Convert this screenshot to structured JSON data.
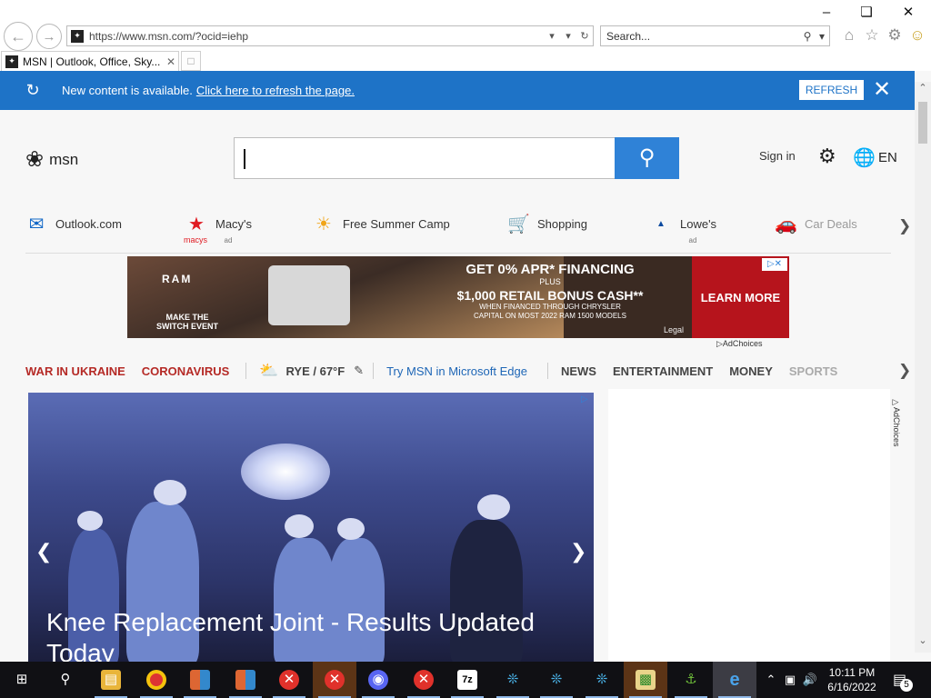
{
  "browser": {
    "address_url": "https://www.msn.com/?ocid=iehp",
    "search_placeholder": "Search...",
    "tab_title": "MSN | Outlook, Office, Sky...",
    "icons": [
      "back-icon",
      "forward-icon",
      "refresh-icon",
      "home-icon",
      "favorites-star-icon",
      "tools-gear-icon",
      "smiley-feedback-icon"
    ]
  },
  "notification": {
    "text": "New content is available.",
    "link": "Click here to refresh the page.",
    "button": "REFRESH",
    "close": "✕"
  },
  "msn": {
    "logo_text": "msn",
    "sign_in": "Sign in",
    "language": "EN",
    "quick_links": [
      {
        "label": "Outlook.com",
        "icon": "outlook-icon",
        "ad": ""
      },
      {
        "label": "Macy's",
        "icon": "macys-star-icon",
        "ad": "ad",
        "sub": "macys"
      },
      {
        "label": "Free Summer Camp",
        "icon": "sun-icon",
        "ad": ""
      },
      {
        "label": "Shopping",
        "icon": "shopping-cart-icon",
        "ad": ""
      },
      {
        "label": "Lowe's",
        "icon": "lowes-icon",
        "ad": "ad",
        "sub": "Lowe's"
      },
      {
        "label": "Car Deals",
        "icon": "car-icon",
        "ad": ""
      }
    ],
    "ad_banner": {
      "brand": "RAM",
      "slogan_line1": "MAKE THE",
      "slogan_line2": "SWITCH EVENT",
      "headline": "GET 0% APR* FINANCING",
      "plus": "PLUS",
      "bonus": "$1,000 RETAIL BONUS CASH**",
      "fine1": "WHEN FINANCED THROUGH CHRYSLER",
      "fine2": "CAPITAL ON MOST 2022 RAM 1500 MODELS",
      "cta": "LEARN MORE",
      "legal": "Legal",
      "adchoices": "AdChoices"
    },
    "topics": {
      "war": "WAR IN UKRAINE",
      "corona": "CORONAVIRUS",
      "weather": "RYE / 67°F",
      "edge": "Try MSN in Microsoft Edge",
      "sections": [
        "NEWS",
        "ENTERTAINMENT",
        "MONEY",
        "SPORTS"
      ]
    },
    "hero": {
      "caption": "Knee Replacement Joint - Results Updated Today"
    },
    "side_ad_label": "AdChoices"
  },
  "taskbar": {
    "time": "10:11 PM",
    "date": "6/16/2022",
    "notification_count": "5",
    "apps": [
      "start-icon",
      "search-icon",
      "file-explorer-icon",
      "chrome-icon",
      "app-icon",
      "app-icon",
      "close-app-icon",
      "close-app-icon",
      "discord-icon",
      "close-app-icon",
      "7zip-icon",
      "fish-icon",
      "fish-icon",
      "fish-icon",
      "chart-app-icon",
      "frog-app-icon",
      "internet-explorer-icon"
    ]
  },
  "colors": {
    "notify_bar": "#1e73c7",
    "search_button": "#2f82d7",
    "topic_red": "#b52a26",
    "link_blue": "#1e66b6"
  }
}
